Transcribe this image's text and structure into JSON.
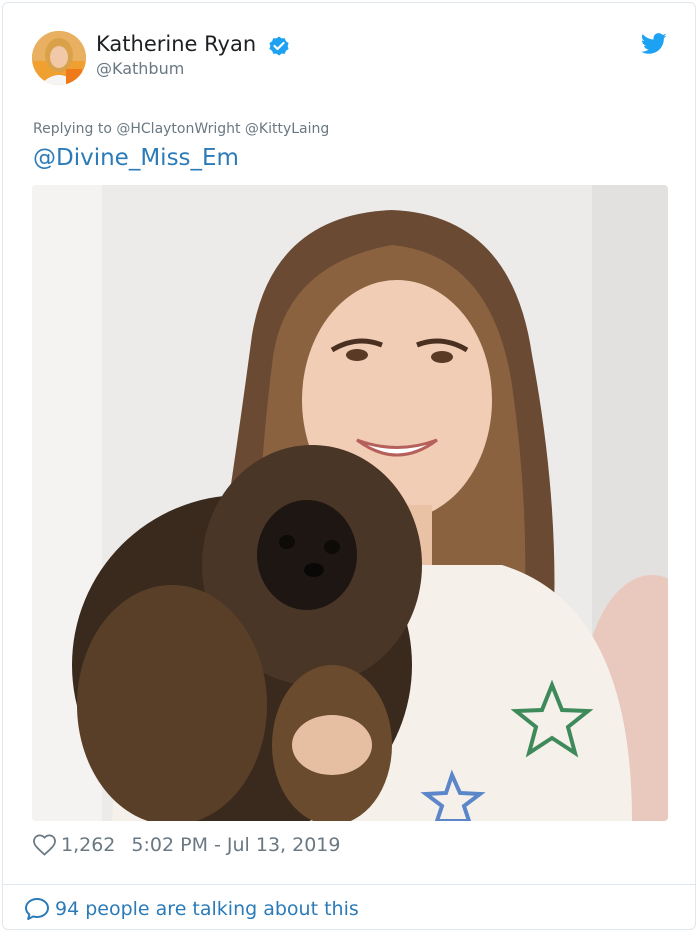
{
  "author": {
    "display_name": "Katherine Ryan",
    "handle": "@Kathbum"
  },
  "tweet": {
    "replying_to": "Replying to @HClaytonWright @KittyLaing",
    "text": "@Divine_Miss_Em",
    "likes": "1,262",
    "timestamp": "5:02 PM - Jul 13, 2019"
  },
  "footer": {
    "talking": "94 people are talking about this"
  },
  "icons": {
    "verified": "verified-badge-icon",
    "brand": "twitter-bird-icon",
    "like": "heart-icon",
    "conversation": "speech-bubble-icon"
  },
  "colors": {
    "link_blue": "#2b7bb9",
    "twitter_blue": "#1da1f2",
    "muted_text": "#697882",
    "border": "#e1e8ed"
  }
}
